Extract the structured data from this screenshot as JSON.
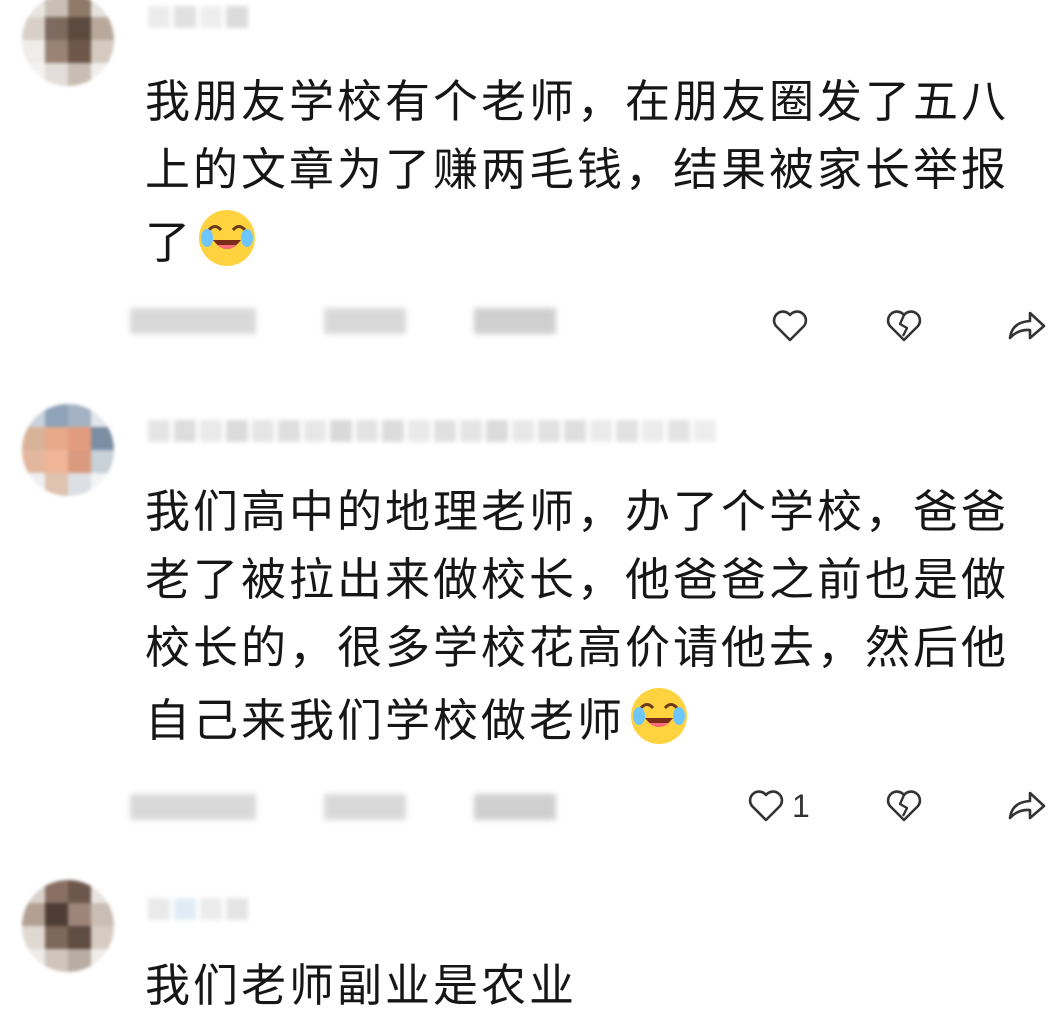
{
  "comments": [
    {
      "text": "我朋友学校有个老师，在朋友圈发了五八上的文章为了赚两毛钱，结果被家长举报了",
      "emoji": "crying-laughing-emoji",
      "like_count": ""
    },
    {
      "text": "我们高中的地理老师，办了个学校，爸爸老了被拉出来做校长，他爸爸之前也是做校长的，很多学校花高价请他去，然后他自己来我们学校做老师",
      "emoji": "crying-laughing-emoji",
      "like_count": "1"
    },
    {
      "text": "我们老师副业是农业",
      "emoji": "",
      "like_count": ""
    }
  ],
  "icons": {
    "like": "heart-outline-icon",
    "dislike": "broken-heart-icon",
    "share": "share-arrow-icon"
  },
  "colors": {
    "text": "#161616",
    "icon": "#333333",
    "emoji_face": "#ffd23f"
  }
}
